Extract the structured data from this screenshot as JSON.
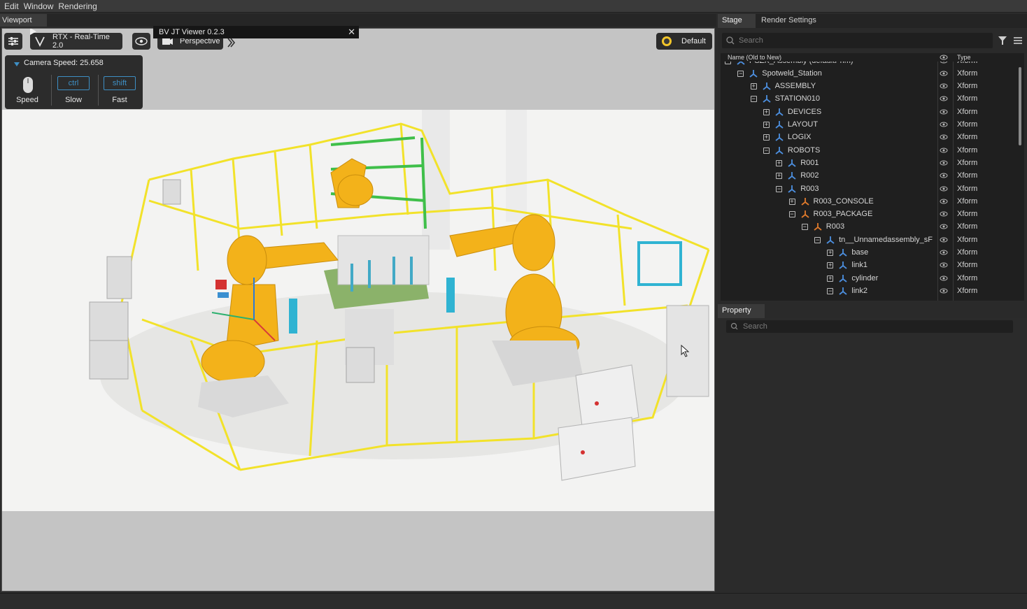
{
  "menu": [
    "Edit",
    "Window",
    "Rendering"
  ],
  "viewport": {
    "tab_label": "Viewport",
    "renderer_label": "RTX - Real-Time 2.0",
    "camera_label": "Perspective",
    "lighting_label": "Default",
    "dialog_title": "BV JT Viewer 0.2.3",
    "dialog_close": "✕",
    "camera_speed": {
      "title": "Camera Speed:",
      "value": "25.658",
      "keys": [
        {
          "key": "",
          "label": "Speed"
        },
        {
          "key": "ctrl",
          "label": "Slow"
        },
        {
          "key": "shift",
          "label": "Fast"
        }
      ]
    }
  },
  "stage": {
    "tabs": [
      "Stage",
      "Render Settings"
    ],
    "search_placeholder": "Search",
    "columns": {
      "name": "Name (Old to New)",
      "type": "Type"
    },
    "rows": [
      {
        "label": "PSZX_Assembly (defaultPrim)",
        "type": "Xform",
        "depth": 0,
        "expander": "minus",
        "icon": "xform"
      },
      {
        "label": "Spotweld_Station",
        "type": "Xform",
        "depth": 1,
        "expander": "minus",
        "icon": "xform"
      },
      {
        "label": "ASSEMBLY",
        "type": "Xform",
        "depth": 2,
        "expander": "plus",
        "icon": "xform"
      },
      {
        "label": "STATION010",
        "type": "Xform",
        "depth": 2,
        "expander": "minus",
        "icon": "xform"
      },
      {
        "label": "DEVICES",
        "type": "Xform",
        "depth": 3,
        "expander": "plus",
        "icon": "xform"
      },
      {
        "label": "LAYOUT",
        "type": "Xform",
        "depth": 3,
        "expander": "plus",
        "icon": "xform"
      },
      {
        "label": "LOGIX",
        "type": "Xform",
        "depth": 3,
        "expander": "plus",
        "icon": "xform"
      },
      {
        "label": "ROBOTS",
        "type": "Xform",
        "depth": 3,
        "expander": "minus",
        "icon": "xform"
      },
      {
        "label": "R001",
        "type": "Xform",
        "depth": 4,
        "expander": "plus",
        "icon": "xform"
      },
      {
        "label": "R002",
        "type": "Xform",
        "depth": 4,
        "expander": "plus",
        "icon": "xform"
      },
      {
        "label": "R003",
        "type": "Xform",
        "depth": 4,
        "expander": "minus",
        "icon": "xform"
      },
      {
        "label": "R003_CONSOLE",
        "type": "Xform",
        "depth": 5,
        "expander": "plus",
        "icon": "xform-ref"
      },
      {
        "label": "R003_PACKAGE",
        "type": "Xform",
        "depth": 5,
        "expander": "minus",
        "icon": "xform-ref"
      },
      {
        "label": "R003",
        "type": "Xform",
        "depth": 6,
        "expander": "minus",
        "icon": "xform-ref"
      },
      {
        "label": "tn__Unnamedassembly_sF",
        "type": "Xform",
        "depth": 7,
        "expander": "minus",
        "icon": "xform"
      },
      {
        "label": "base",
        "type": "Xform",
        "depth": 8,
        "expander": "plus",
        "icon": "xform"
      },
      {
        "label": "link1",
        "type": "Xform",
        "depth": 8,
        "expander": "plus",
        "icon": "xform"
      },
      {
        "label": "cylinder",
        "type": "Xform",
        "depth": 8,
        "expander": "plus",
        "icon": "xform"
      },
      {
        "label": "link2",
        "type": "Xform",
        "depth": 8,
        "expander": "minus",
        "icon": "xform"
      }
    ]
  },
  "property": {
    "tab_label": "Property",
    "search_placeholder": "Search"
  }
}
